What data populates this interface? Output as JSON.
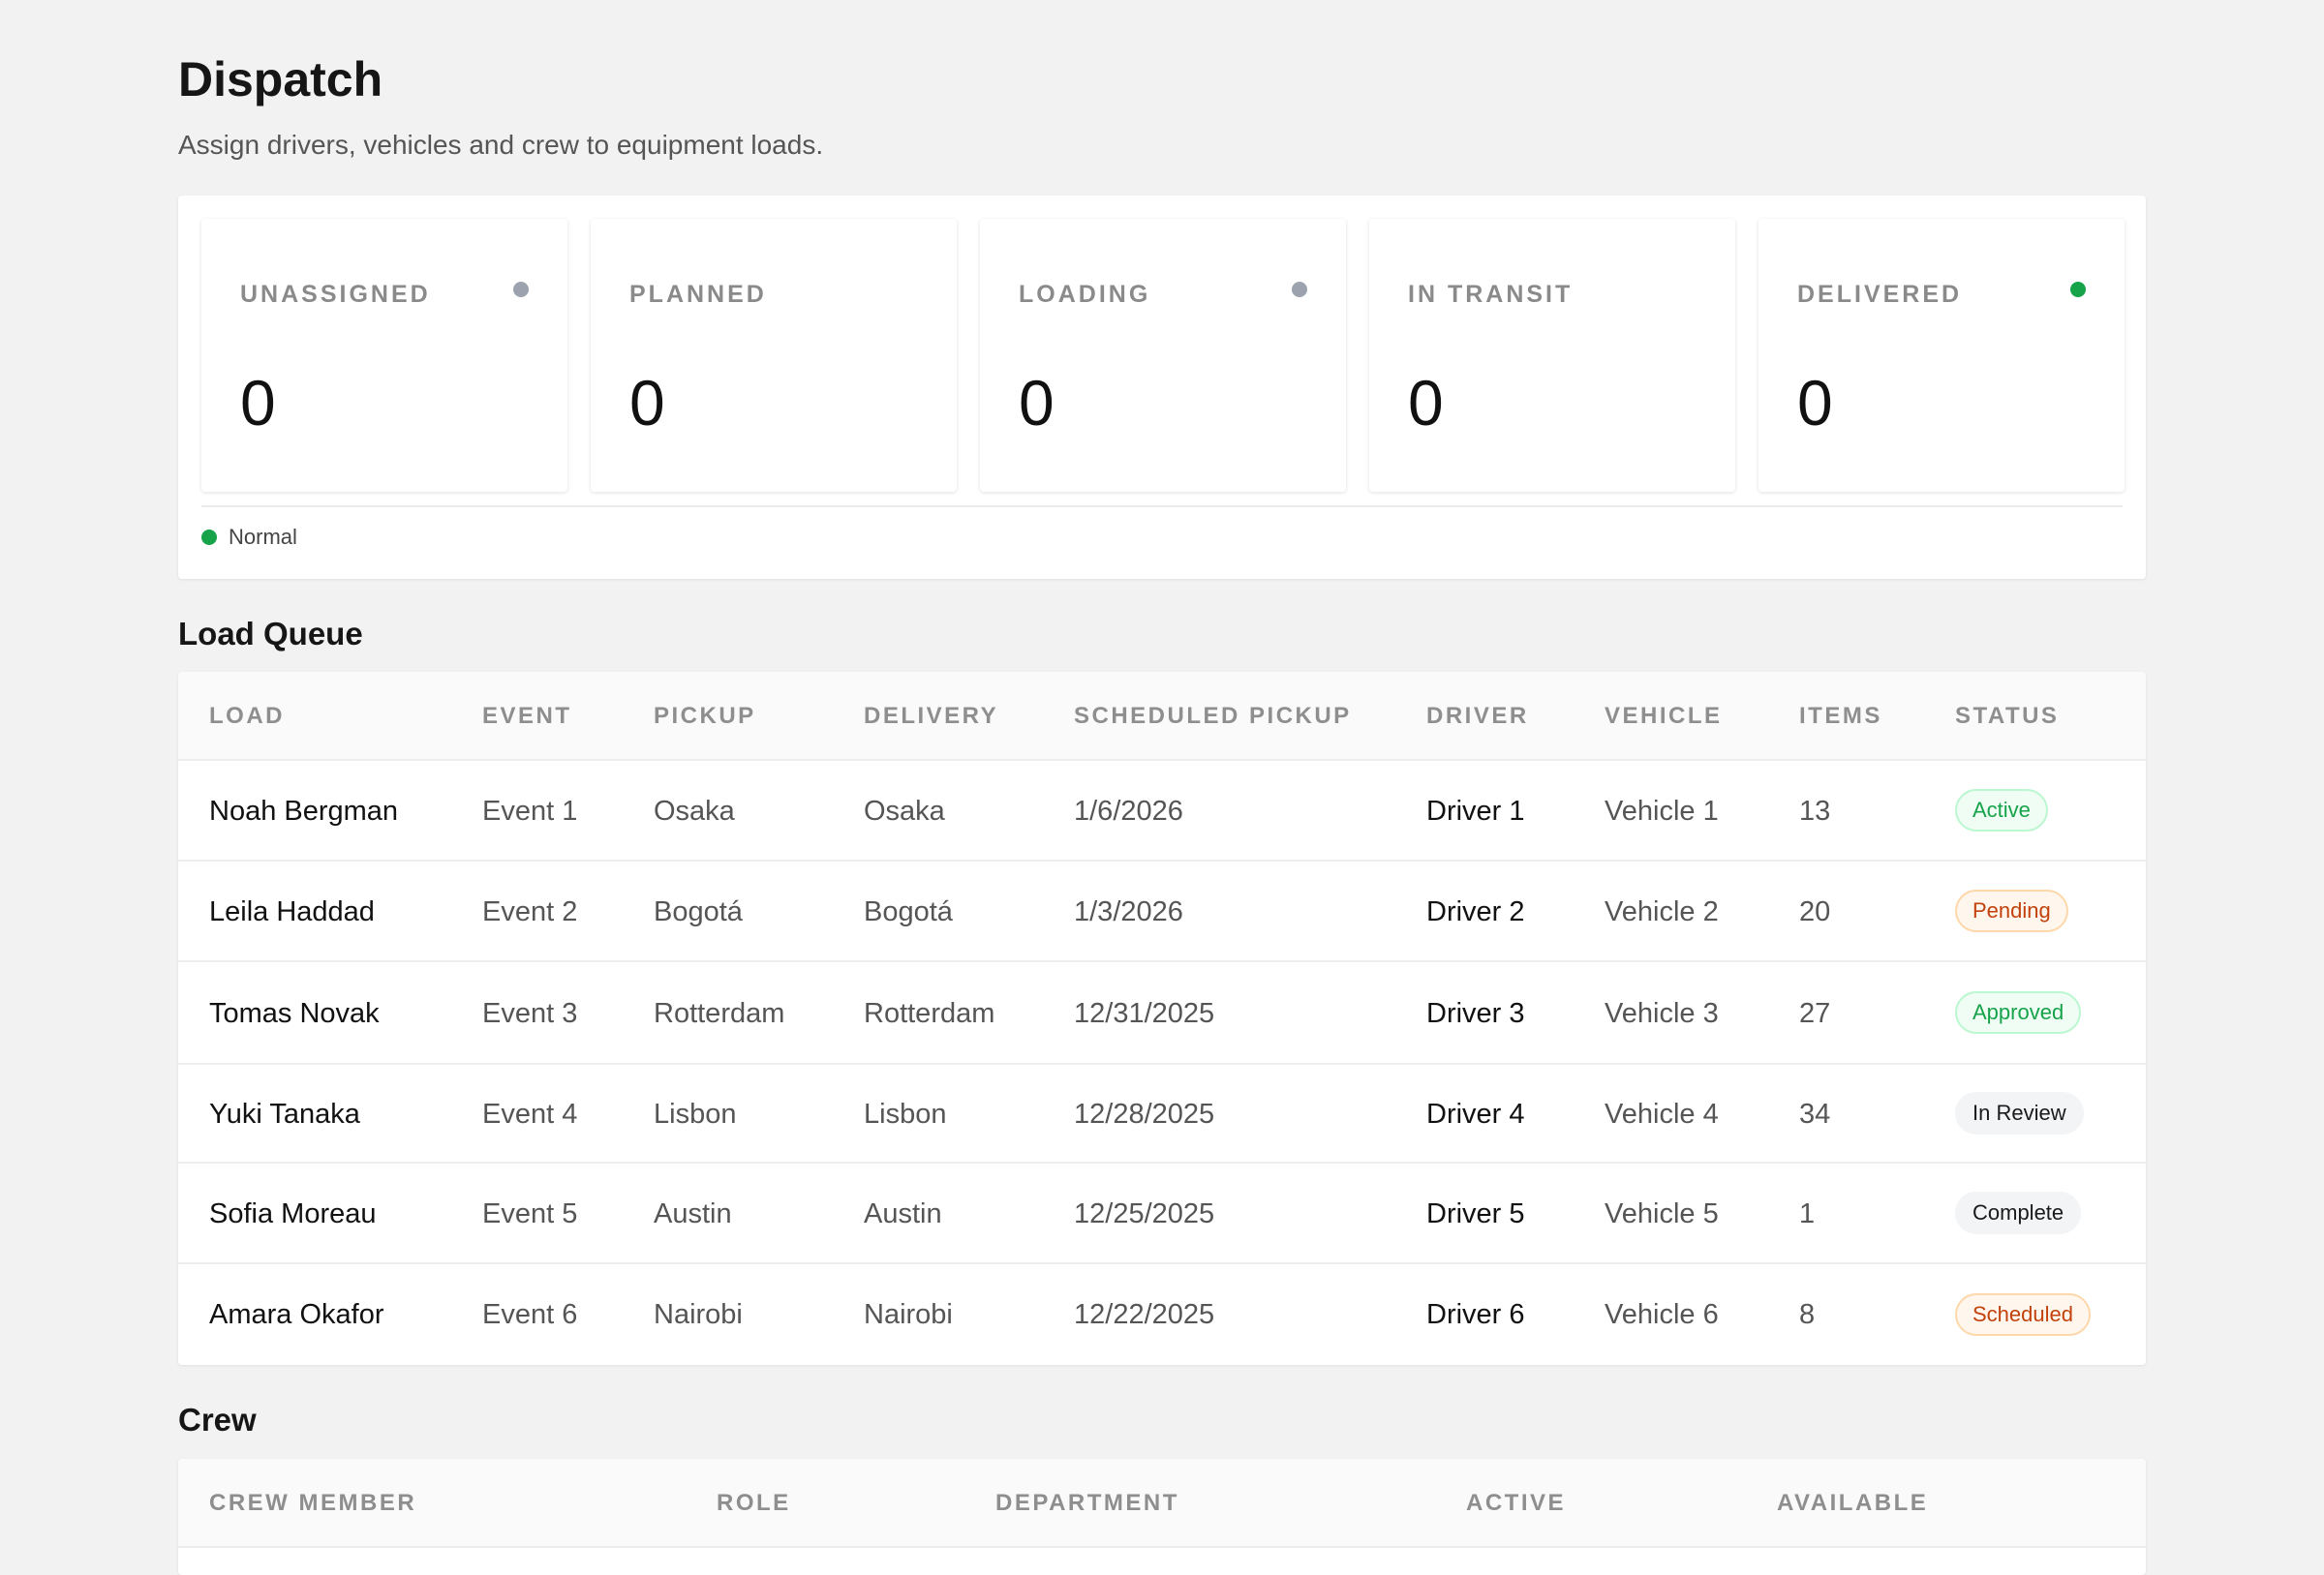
{
  "header": {
    "title": "Dispatch",
    "subtitle": "Assign drivers, vehicles and crew to equipment loads."
  },
  "stats": {
    "cards": [
      {
        "label": "UNASSIGNED",
        "value": "0",
        "dot_color": "#9ca3af",
        "dot": true
      },
      {
        "label": "PLANNED",
        "value": "0",
        "dot": false
      },
      {
        "label": "LOADING",
        "value": "0",
        "dot_color": "#9ca3af",
        "dot": true
      },
      {
        "label": "IN TRANSIT",
        "value": "0",
        "dot": false
      },
      {
        "label": "DELIVERED",
        "value": "0",
        "dot_color": "#16a34a",
        "dot": true
      }
    ],
    "legend": {
      "label": "Normal",
      "color": "#16a34a"
    }
  },
  "load_queue": {
    "title": "Load Queue",
    "columns": [
      "LOAD",
      "EVENT",
      "PICKUP",
      "DELIVERY",
      "SCHEDULED PICKUP",
      "DRIVER",
      "VEHICLE",
      "ITEMS",
      "STATUS"
    ],
    "rows": [
      {
        "load": "Noah Bergman",
        "event": "Event 1",
        "pickup": "Osaka",
        "delivery": "Osaka",
        "scheduled": "1/6/2026",
        "driver": "Driver 1",
        "vehicle": "Vehicle 1",
        "items": "13",
        "status": "Active",
        "status_kind": "green"
      },
      {
        "load": "Leila Haddad",
        "event": "Event 2",
        "pickup": "Bogotá",
        "delivery": "Bogotá",
        "scheduled": "1/3/2026",
        "driver": "Driver 2",
        "vehicle": "Vehicle 2",
        "items": "20",
        "status": "Pending",
        "status_kind": "orange"
      },
      {
        "load": "Tomas Novak",
        "event": "Event 3",
        "pickup": "Rotterdam",
        "delivery": "Rotterdam",
        "scheduled": "12/31/2025",
        "driver": "Driver 3",
        "vehicle": "Vehicle 3",
        "items": "27",
        "status": "Approved",
        "status_kind": "green"
      },
      {
        "load": "Yuki Tanaka",
        "event": "Event 4",
        "pickup": "Lisbon",
        "delivery": "Lisbon",
        "scheduled": "12/28/2025",
        "driver": "Driver 4",
        "vehicle": "Vehicle 4",
        "items": "34",
        "status": "In Review",
        "status_kind": "gray"
      },
      {
        "load": "Sofia Moreau",
        "event": "Event 5",
        "pickup": "Austin",
        "delivery": "Austin",
        "scheduled": "12/25/2025",
        "driver": "Driver 5",
        "vehicle": "Vehicle 5",
        "items": "1",
        "status": "Complete",
        "status_kind": "gray"
      },
      {
        "load": "Amara Okafor",
        "event": "Event 6",
        "pickup": "Nairobi",
        "delivery": "Nairobi",
        "scheduled": "12/22/2025",
        "driver": "Driver 6",
        "vehicle": "Vehicle 6",
        "items": "8",
        "status": "Scheduled",
        "status_kind": "orange"
      }
    ]
  },
  "crew": {
    "title": "Crew",
    "columns": [
      "CREW MEMBER",
      "ROLE",
      "DEPARTMENT",
      "ACTIVE",
      "AVAILABLE"
    ]
  },
  "badge_colors": {
    "green": {
      "text": "#16a34a",
      "bg": "#f0fdf4",
      "border": "#bbf7d0"
    },
    "orange": {
      "text": "#c2410c",
      "bg": "#fff7ed",
      "border": "#fed7aa"
    },
    "gray": {
      "text": "#1a1a1a",
      "bg": "#f3f4f6",
      "border": "#f3f4f6"
    }
  }
}
